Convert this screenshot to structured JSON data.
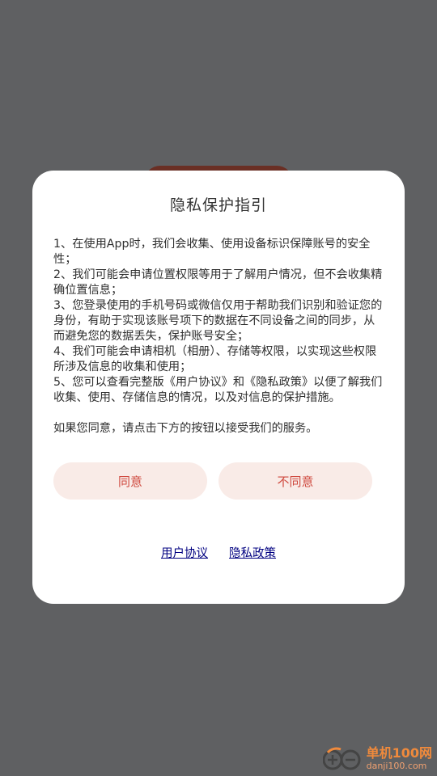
{
  "dialog": {
    "title": "隐私保护指引",
    "paragraphs": [
      "1、在使用App时，我们会收集、使用设备标识保障账号的安全性；",
      "2、我们可能会申请位置权限等用于了解用户情况，但不会收集精确位置信息；",
      "3、您登录使用的手机号码或微信仅用于帮助我们识别和验证您的身份，有助于实现该账号项下的数据在不同设备之间的同步，从而避免您的数据丢失，保护账号安全；",
      "4、我们可能会申请相机（相册）、存储等权限，以实现这些权限所涉及信息的收集和使用；",
      "5、您可以查看完整版《用户协议》和《隐私政策》以便了解我们收集、使用、存储信息的情况，以及对信息的保护措施。"
    ],
    "closing": "如果您同意，请点击下方的按钮以接受我们的服务。",
    "agree_label": "同意",
    "disagree_label": "不同意",
    "user_agreement_link": "用户协议",
    "privacy_policy_link": "隐私政策"
  },
  "watermark": {
    "name": "单机100网",
    "domain": "danji100.com"
  },
  "colors": {
    "overlay": "#5f6062",
    "button_bg": "#f9ebe7",
    "button_text": "#cf4a3f",
    "link": "#000080"
  }
}
